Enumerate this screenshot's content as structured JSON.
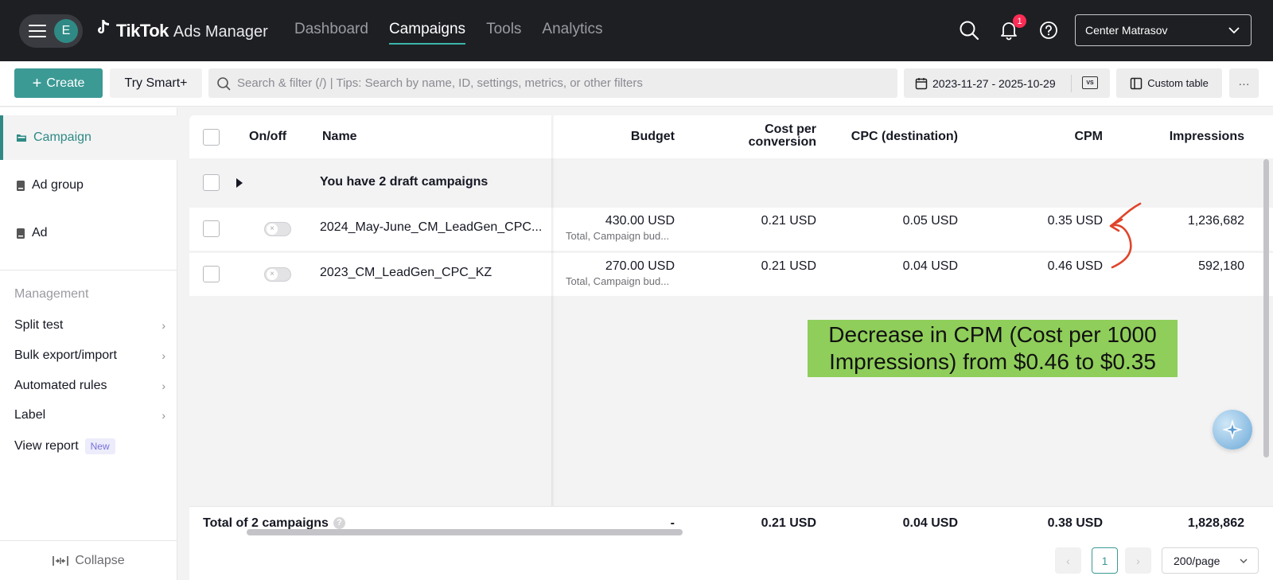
{
  "header": {
    "avatar_letter": "E",
    "brand_main": "TikTok",
    "brand_sub": "Ads Manager",
    "nav": [
      {
        "label": "Dashboard",
        "active": false
      },
      {
        "label": "Campaigns",
        "active": true
      },
      {
        "label": "Tools",
        "active": false
      },
      {
        "label": "Analytics",
        "active": false
      }
    ],
    "notification_count": "1",
    "account_name": "Center Matrasov"
  },
  "toolbar": {
    "create_label": "Create",
    "smart_label": "Try Smart+",
    "search_placeholder": "Search & filter (/) | Tips: Search by name, ID, settings, metrics, or other filters",
    "date_range": "2023-11-27 - 2025-10-29",
    "compare_label": "VS",
    "custom_table_label": "Custom table",
    "more_label": "···"
  },
  "sidebar": {
    "levels": [
      {
        "label": "Campaign",
        "active": true
      },
      {
        "label": "Ad group",
        "active": false
      },
      {
        "label": "Ad",
        "active": false
      }
    ],
    "management_heading": "Management",
    "links": [
      {
        "label": "Split test"
      },
      {
        "label": "Bulk export/import"
      },
      {
        "label": "Automated rules"
      },
      {
        "label": "Label"
      }
    ],
    "view_report_label": "View report",
    "new_tag": "New",
    "collapse_label": "Collapse"
  },
  "table": {
    "columns": {
      "onoff": "On/off",
      "name": "Name",
      "budget": "Budget",
      "cost_per_conversion_l1": "Cost per",
      "cost_per_conversion_l2": "conversion",
      "cpc": "CPC (destination)",
      "cpm": "CPM",
      "impressions": "Impressions"
    },
    "draft_label": "You have 2 draft campaigns",
    "rows": [
      {
        "name": "2024_May-June_CM_LeadGen_CPC...",
        "budget": "430.00 USD",
        "budget_sub": "Total, Campaign bud...",
        "cost_per_conversion": "0.21 USD",
        "cpc": "0.05 USD",
        "cpm": "0.35 USD",
        "impressions": "1,236,682"
      },
      {
        "name": "2023_CM_LeadGen_CPC_KZ",
        "budget": "270.00 USD",
        "budget_sub": "Total, Campaign bud...",
        "cost_per_conversion": "0.21 USD",
        "cpc": "0.04 USD",
        "cpm": "0.46 USD",
        "impressions": "592,180"
      }
    ],
    "total": {
      "label": "Total of 2 campaigns",
      "help": "?",
      "budget": "-",
      "cost_per_conversion": "0.21 USD",
      "cpc": "0.04 USD",
      "cpm": "0.38 USD",
      "impressions": "1,828,862"
    }
  },
  "annotation": {
    "line1": "Decrease in CPM (Cost per 1000",
    "line2": "Impressions) from $0.46 to $0.35",
    "arrow_color": "#e0442a",
    "box_color": "#8fce5a"
  },
  "pagination": {
    "current_page": "1",
    "page_size": "200/page"
  },
  "colors": {
    "accent": "#3c9a95",
    "topbar": "#1e1f23",
    "badge": "#fe2c55"
  }
}
